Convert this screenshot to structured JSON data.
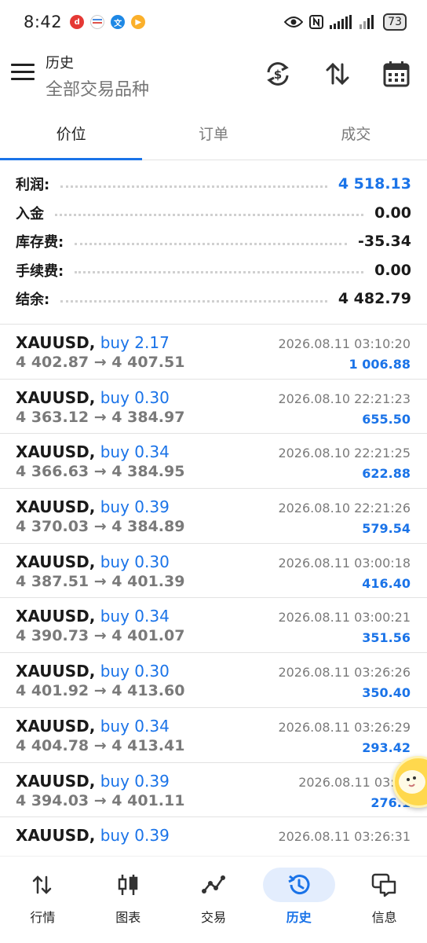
{
  "status_bar": {
    "time": "8:42",
    "battery": "73"
  },
  "header": {
    "title": "历史",
    "subtitle": "全部交易品种"
  },
  "tabs": [
    {
      "label": "价位"
    },
    {
      "label": "订单"
    },
    {
      "label": "成交"
    }
  ],
  "summary": [
    {
      "label": "利润:",
      "value": "4 518.13"
    },
    {
      "label": "入金",
      "value": "0.00"
    },
    {
      "label": "库存费:",
      "value": "-35.34"
    },
    {
      "label": "手续费:",
      "value": "0.00"
    },
    {
      "label": "结余:",
      "value": "4 482.79"
    }
  ],
  "trades": [
    {
      "symbol": "XAUUSD,",
      "side": "buy 2.17",
      "prices": "4 402.87 → 4 407.51",
      "time": "2026.08.11 03:10:20",
      "profit": "1 006.88"
    },
    {
      "symbol": "XAUUSD,",
      "side": "buy 0.30",
      "prices": "4 363.12 → 4 384.97",
      "time": "2026.08.10 22:21:23",
      "profit": "655.50"
    },
    {
      "symbol": "XAUUSD,",
      "side": "buy 0.34",
      "prices": "4 366.63 → 4 384.95",
      "time": "2026.08.10 22:21:25",
      "profit": "622.88"
    },
    {
      "symbol": "XAUUSD,",
      "side": "buy 0.39",
      "prices": "4 370.03 → 4 384.89",
      "time": "2026.08.10 22:21:26",
      "profit": "579.54"
    },
    {
      "symbol": "XAUUSD,",
      "side": "buy 0.30",
      "prices": "4 387.51 → 4 401.39",
      "time": "2026.08.11 03:00:18",
      "profit": "416.40"
    },
    {
      "symbol": "XAUUSD,",
      "side": "buy 0.34",
      "prices": "4 390.73 → 4 401.07",
      "time": "2026.08.11 03:00:21",
      "profit": "351.56"
    },
    {
      "symbol": "XAUUSD,",
      "side": "buy 0.30",
      "prices": "4 401.92 → 4 413.60",
      "time": "2026.08.11 03:26:26",
      "profit": "350.40"
    },
    {
      "symbol": "XAUUSD,",
      "side": "buy 0.34",
      "prices": "4 404.78 → 4 413.41",
      "time": "2026.08.11 03:26:29",
      "profit": "293.42"
    },
    {
      "symbol": "XAUUSD,",
      "side": "buy 0.39",
      "prices": "4 394.03 → 4 401.11",
      "time": "2026.08.11 03:00",
      "profit": "276.1"
    },
    {
      "symbol": "XAUUSD,",
      "side": "buy 0.39",
      "prices": "",
      "time": "2026.08.11 03:26:31",
      "profit": ""
    }
  ],
  "bottom_nav": [
    {
      "label": "行情",
      "icon": "quotes-arrows-icon"
    },
    {
      "label": "图表",
      "icon": "candlestick-chart-icon"
    },
    {
      "label": "交易",
      "icon": "trade-line-icon"
    },
    {
      "label": "历史",
      "icon": "history-clock-icon"
    },
    {
      "label": "信息",
      "icon": "messages-icon"
    }
  ],
  "colors": {
    "accent": "#1a73e8",
    "text": "#1a1a1a",
    "muted": "#7a7a7a",
    "divider": "#e2e2e2",
    "nav_active_bg": "#e3edfd"
  }
}
